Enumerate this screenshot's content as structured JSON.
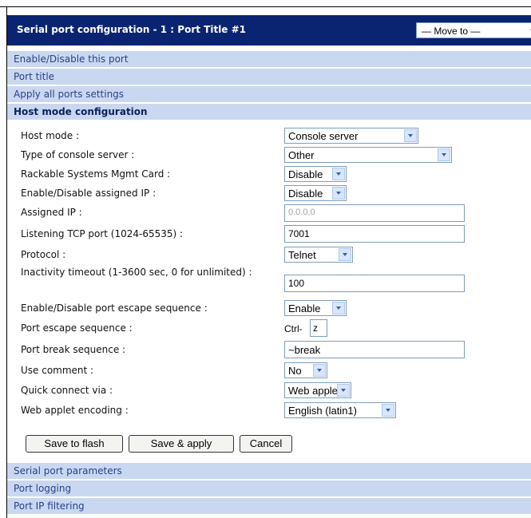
{
  "header": {
    "title": "Serial port configuration - 1 : Port Title #1",
    "move_to": "— Move to —"
  },
  "sections_top": [
    {
      "label": "Enable/Disable this port"
    },
    {
      "label": "Port title"
    },
    {
      "label": "Apply all ports settings"
    }
  ],
  "active_section": "Host mode configuration",
  "fields": {
    "host_mode": {
      "label": "Host mode :",
      "value": "Console server"
    },
    "console_type": {
      "label": "Type of console server :",
      "value": "Other"
    },
    "rackable": {
      "label": "Rackable Systems Mgmt Card :",
      "value": "Disable"
    },
    "assigned_ip_toggle": {
      "label": "Enable/Disable assigned IP :",
      "value": "Disable"
    },
    "assigned_ip": {
      "label": "Assigned IP :",
      "value": "0.0.0.0"
    },
    "tcp_port": {
      "label": "Listening TCP port (1024-65535) :",
      "value": "7001"
    },
    "protocol": {
      "label": "Protocol :",
      "value": "Telnet"
    },
    "inactivity": {
      "label": "Inactivity timeout (1-3600 sec, 0 for unlimited) :",
      "value": "100"
    },
    "escape_toggle": {
      "label": "Enable/Disable port escape sequence :",
      "value": "Enable"
    },
    "escape_seq": {
      "label": "Port escape sequence :",
      "prefix": "Ctrl-",
      "value": "z"
    },
    "break_seq": {
      "label": "Port break sequence :",
      "value": "~break"
    },
    "use_comment": {
      "label": "Use comment :",
      "value": "No"
    },
    "quick_connect": {
      "label": "Quick connect via :",
      "value": "Web applet"
    },
    "applet_encoding": {
      "label": "Web applet encoding :",
      "value": "English (latin1)"
    }
  },
  "buttons": {
    "save_flash": "Save to flash",
    "save_apply": "Save & apply",
    "cancel": "Cancel"
  },
  "sections_bottom": [
    {
      "label": "Serial port parameters"
    },
    {
      "label": "Port logging"
    },
    {
      "label": "Port IP filtering"
    }
  ],
  "colors": {
    "title_bar": "#0a2472",
    "section_bg": "#c9d8f0",
    "section_text": "#2a3f8a"
  }
}
